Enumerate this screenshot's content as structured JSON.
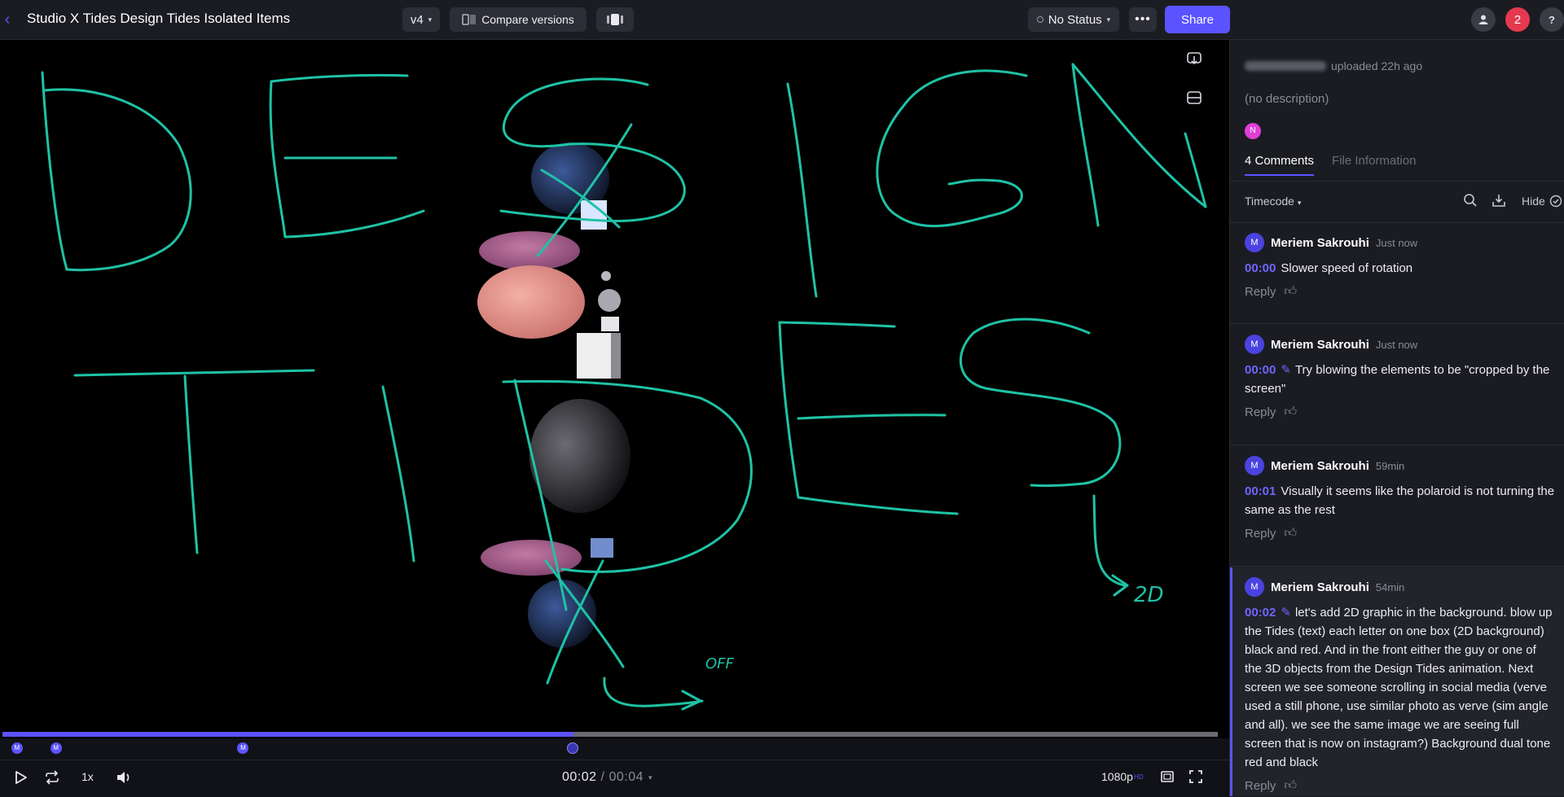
{
  "header": {
    "back_icon": "chevron-left-icon",
    "title": "Studio X Tides Design Tides Isolated Items",
    "version": "v4",
    "compare_label": "Compare versions",
    "status_label": "No Status",
    "more_label": "•••",
    "share_label": "Share",
    "notification_count": "2",
    "help_label": "?"
  },
  "player": {
    "current_time": "00:02",
    "separator": "/",
    "total_time": "00:04",
    "speed": "1x",
    "resolution": "1080p",
    "resolution_badge": "HD",
    "progress": 0.47,
    "markers": [
      {
        "label": "M",
        "position": 0.012
      },
      {
        "label": "M",
        "position": 0.044
      },
      {
        "label": "M",
        "position": 0.198
      },
      {
        "label": "",
        "position": 0.469
      }
    ],
    "annotation_texts": [
      "2D",
      "OFF"
    ]
  },
  "panel": {
    "uploaded_text": "uploaded 22h ago",
    "description": "(no description)",
    "avatar_initial": "N",
    "tabs": [
      {
        "label": "4 Comments",
        "active": true
      },
      {
        "label": "File Information",
        "active": false
      }
    ],
    "filter_label": "Timecode",
    "hide_label": "Hide",
    "comments": [
      {
        "initial": "M",
        "author": "Meriem Sakrouhi",
        "time": "Just now",
        "timecode": "00:00",
        "has_drawing": false,
        "text": "Slower speed of rotation",
        "reply": "Reply"
      },
      {
        "initial": "M",
        "author": "Meriem Sakrouhi",
        "time": "Just now",
        "timecode": "00:00",
        "has_drawing": true,
        "text": "Try blowing the elements to be \"cropped by the screen\"",
        "reply": "Reply"
      },
      {
        "initial": "M",
        "author": "Meriem Sakrouhi",
        "time": "59min",
        "timecode": "00:01",
        "has_drawing": false,
        "text": "Visually it seems like the polaroid is not turning the same as the rest",
        "reply": "Reply"
      },
      {
        "initial": "M",
        "author": "Meriem Sakrouhi",
        "time": "54min",
        "timecode": "00:02",
        "has_drawing": true,
        "text": "let's add 2D graphic in the background. blow up the Tides (text) each letter on one box (2D background) black and red. And in the front either the guy or one of the 3D objects from the Design Tides animation. Next screen we see someone scrolling in social media (verve used a still phone, use similar photo as verve (sim angle and all). we see the same image we are seeing full screen that is now on instagram?) Background dual tone red and black",
        "reply": "Reply"
      }
    ]
  },
  "colors": {
    "accent": "#5b53ff",
    "annotation": "#1fc2a6",
    "badge": "#e5394f"
  }
}
